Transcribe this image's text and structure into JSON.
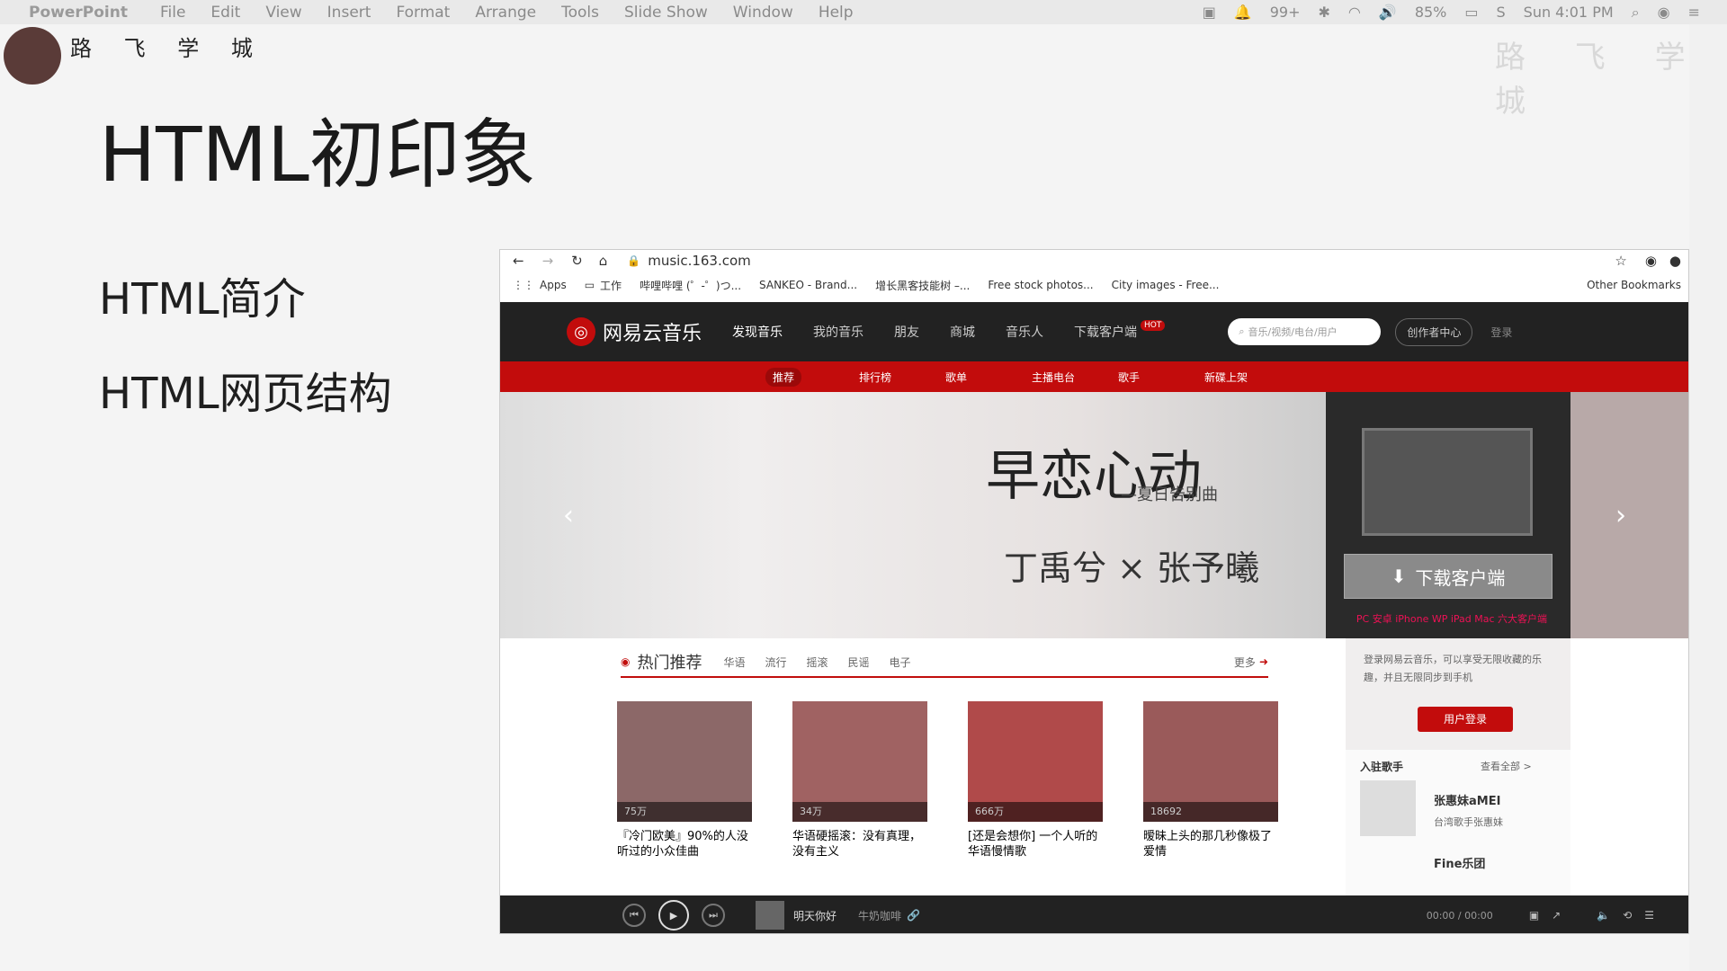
{
  "menubar": {
    "app": "PowerPoint",
    "items": [
      "File",
      "Edit",
      "View",
      "Insert",
      "Format",
      "Arrange",
      "Tools",
      "Slide Show",
      "Window",
      "Help"
    ],
    "notifications": "99+",
    "battery": "85%",
    "clock": "Sun 4:01 PM"
  },
  "slide": {
    "logo_text": "路 飞 学 城",
    "watermark": "路 飞 学 城",
    "title": "HTML初印象",
    "bullets": [
      "HTML简介",
      "HTML网页结构"
    ]
  },
  "browser": {
    "url": "music.163.com",
    "bookmarks": [
      "Apps",
      "工作",
      "哔哩哔哩 (゜-゜)つ...",
      "SANKEO - Brand...",
      "增长黑客技能树 –...",
      "Free stock photos...",
      "City images - Free..."
    ],
    "other_bookmarks": "Other Bookmarks",
    "site": {
      "brand": "网易云音乐",
      "nav": [
        "发现音乐",
        "我的音乐",
        "朋友",
        "商城",
        "音乐人",
        "下载客户端"
      ],
      "hot_badge": "HOT",
      "search_placeholder": "音乐/视频/电台/用户",
      "creator": "创作者中心",
      "login": "登录",
      "subnav": [
        "推荐",
        "排行榜",
        "歌单",
        "主播电台",
        "歌手",
        "新碟上架"
      ],
      "banner": {
        "title": "早恋心动",
        "subtitle": "—夏日告别曲",
        "artists": "丁禹兮 × 张予曦",
        "download_button": "下载客户端",
        "download_sub": "PC 安卓 iPhone WP iPad Mac 六大客户端"
      },
      "hot": {
        "title": "热门推荐",
        "tags": [
          "华语",
          "流行",
          "摇滚",
          "民谣",
          "电子"
        ],
        "more": "更多",
        "cards": [
          {
            "count": "75万",
            "name": "『冷门欧美』90%的人没听过的小众佳曲"
          },
          {
            "count": "34万",
            "name": "华语硬摇滚：没有真理，没有主义"
          },
          {
            "count": "666万",
            "name": "[还是会想你] 一个人听的华语慢情歌"
          },
          {
            "count": "18692",
            "name": "暧昧上头的那几秒像极了爱情"
          }
        ]
      },
      "side": {
        "login_text": "登录网易云音乐，可以享受无限收藏的乐趣，并且无限同步到手机",
        "login_button": "用户登录",
        "singers_title": "入驻歌手",
        "view_all": "查看全部 >",
        "singer1": "张惠妹aMEI",
        "singer1_desc": "台湾歌手张惠妹",
        "singer2": "Fine乐团"
      },
      "player": {
        "song": "明天你好",
        "artist": "牛奶咖啡",
        "time": "00:00 / 00:00"
      }
    }
  }
}
